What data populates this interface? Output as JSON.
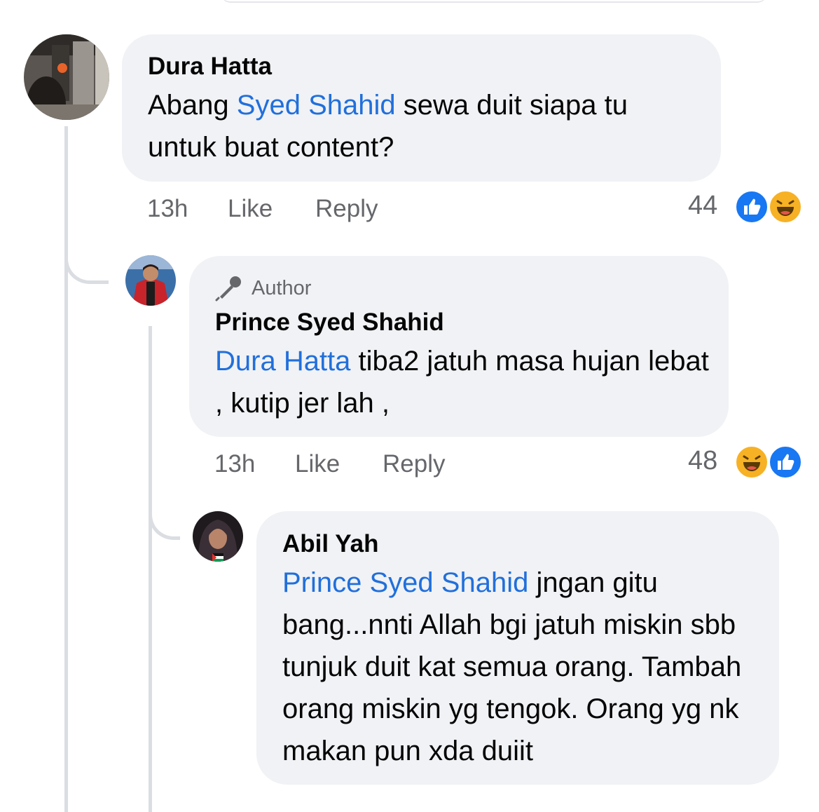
{
  "comments": [
    {
      "name": "Dura Hatta",
      "text_before": "Abang ",
      "mention": "Syed Shahid",
      "text_after": " sewa duit siapa tu untuk buat content?",
      "time": "13h",
      "like_label": "Like",
      "reply_label": "Reply",
      "reaction_count": "44",
      "reactions": [
        "like-icon",
        "haha-icon"
      ]
    },
    {
      "badge": "Author",
      "name": "Prince Syed Shahid",
      "mention": "Dura Hatta",
      "text_after": " tiba2 jatuh masa hujan lebat , kutip jer lah ,",
      "time": "13h",
      "like_label": "Like",
      "reply_label": "Reply",
      "reaction_count": "48",
      "reactions": [
        "haha-icon",
        "like-icon"
      ]
    },
    {
      "name": "Abil Yah",
      "mention": "Prince Syed Shahid",
      "text_after": " jngan gitu bang...nnti Allah bgi jatuh miskin sbb tunjuk duit kat semua orang. Tambah orang miskin yg tengok. Orang yg nk makan pun xda duiit"
    }
  ],
  "colors": {
    "mention": "#216fdb",
    "bubble": "#f0f2f5",
    "meta": "#65676b",
    "like": "#1877f2",
    "haha": "#f7b125"
  }
}
